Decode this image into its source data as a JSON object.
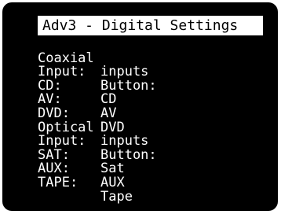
{
  "screen": {
    "title": "Adv3 - Digital Settings",
    "rows": [
      {
        "label": "Coaxial",
        "value": "inputs"
      },
      {
        "label": "Input:",
        "value": "Button:"
      },
      {
        "label": "CD:",
        "value": "CD"
      },
      {
        "label": "AV:",
        "value": "AV"
      },
      {
        "label": "DVD:",
        "value": "DVD"
      },
      {
        "label": "Optical",
        "value": "inputs"
      },
      {
        "label": "Input:",
        "value": "Button:"
      },
      {
        "label": "SAT:",
        "value": "Sat"
      },
      {
        "label": "AUX:",
        "value": "AUX"
      },
      {
        "label": "TAPE:",
        "value": "Tape"
      }
    ]
  }
}
